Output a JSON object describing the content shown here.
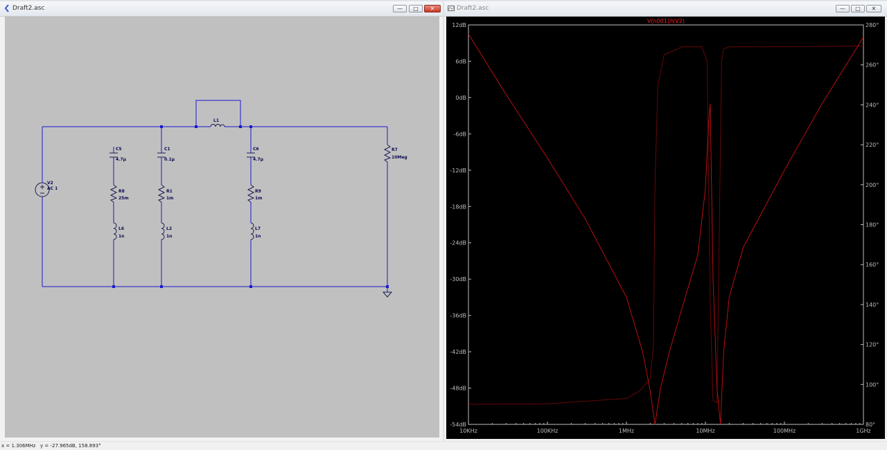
{
  "schematic_window": {
    "title": "Draft2.asc",
    "buttons": {
      "minimize": "—",
      "maximize": "□",
      "close": "✕"
    },
    "components": [
      {
        "ref": "V2",
        "value": "AC 1"
      },
      {
        "ref": "C5",
        "value": "4.7µ"
      },
      {
        "ref": "R8",
        "value": "25m"
      },
      {
        "ref": "L6",
        "value": "1n"
      },
      {
        "ref": "C1",
        "value": "0.1µ"
      },
      {
        "ref": "R1",
        "value": "1m"
      },
      {
        "ref": "L2",
        "value": "1n"
      },
      {
        "ref": "C6",
        "value": "4.7µ"
      },
      {
        "ref": "R9",
        "value": "1m"
      },
      {
        "ref": "L7",
        "value": "1n"
      },
      {
        "ref": "L1",
        "value": ""
      },
      {
        "ref": "R7",
        "value": "10Meg"
      }
    ],
    "colors": {
      "background": "#c0c0c0",
      "wire": "#1a1acc",
      "component": "#1a1a55"
    }
  },
  "plot_window": {
    "title": "Draft2.asc",
    "buttons": {
      "minimize": "—",
      "maximize": "□",
      "close": "✕"
    },
    "trace_label": "V(n001)/I(V2)",
    "colors": {
      "background": "#000000",
      "trace": "#cc1111",
      "axis": "#bfbfbf",
      "label": "#ff2020"
    }
  },
  "chart_data": {
    "type": "line",
    "title": "V(n001)/I(V2)",
    "xscale": "log",
    "x_ticks": [
      "10KHz",
      "100KHz",
      "1MHz",
      "10MHz",
      "100MHz",
      "1GHz"
    ],
    "y_left_ticks": [
      "12dB",
      "6dB",
      "0dB",
      "-6dB",
      "-12dB",
      "-18dB",
      "-24dB",
      "-30dB",
      "-36dB",
      "-42dB",
      "-48dB",
      "-54dB"
    ],
    "y_right_ticks": [
      "280°",
      "260°",
      "240°",
      "220°",
      "200°",
      "180°",
      "160°",
      "140°",
      "120°",
      "100°",
      "80°"
    ],
    "xlim": [
      10000,
      1000000000
    ],
    "ylim_left": [
      -54,
      12
    ],
    "ylim_right": [
      80,
      280
    ],
    "series": [
      {
        "name": "magnitude",
        "axis": "left",
        "x": [
          10000,
          30000,
          100000,
          300000,
          1000000,
          1600000,
          2000000,
          2300000,
          2700000,
          3500000,
          5000000,
          8000000,
          10000000,
          11000000,
          11500000,
          12500000,
          14000000,
          15500000,
          17000000,
          20000000,
          30000000,
          100000000,
          300000000,
          1000000000
        ],
        "y": [
          10.5,
          0.5,
          -10,
          -20,
          -33,
          -42,
          -48.5,
          -54,
          -48,
          -42,
          -35,
          -26,
          -15,
          -4,
          -1,
          -30,
          -48,
          -54,
          -42,
          -33,
          -24.8,
          -12,
          -1,
          10
        ]
      },
      {
        "name": "phase",
        "axis": "right",
        "x": [
          10000,
          100000,
          1000000,
          1500000,
          2000000,
          2200000,
          2300000,
          2500000,
          3000000,
          5000000,
          9000000,
          10500000,
          11500000,
          12500000,
          14000000,
          15000000,
          16000000,
          17000000,
          20000000,
          50000000,
          500000000,
          1000000000
        ],
        "y": [
          90,
          90.3,
          93,
          97,
          103,
          120,
          200,
          250,
          265,
          269,
          269,
          262,
          140,
          92,
          91,
          180,
          262,
          268,
          269,
          269,
          269.3,
          269.5
        ]
      }
    ]
  },
  "status_bar": {
    "x_readout": "x = 1.306MHz",
    "y_readout": "y = -27.965dB, 158.893°"
  }
}
